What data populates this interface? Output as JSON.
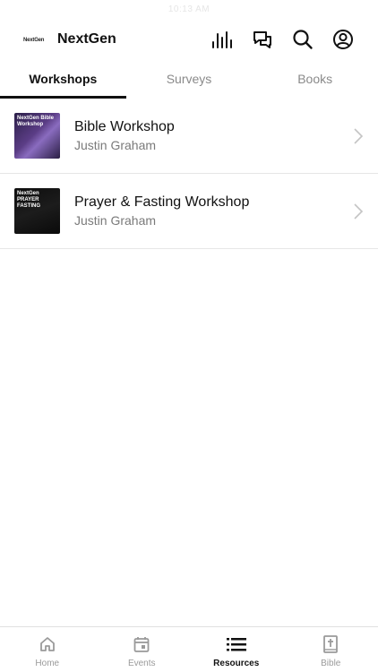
{
  "status": {
    "time": "10:13 AM"
  },
  "header": {
    "logo_text": "NextGen",
    "title": "NextGen",
    "icons": [
      "stats-icon",
      "chat-icon",
      "search-icon",
      "profile-icon"
    ]
  },
  "tabs": [
    {
      "label": "Workshops",
      "active": true
    },
    {
      "label": "Surveys",
      "active": false
    },
    {
      "label": "Books",
      "active": false
    }
  ],
  "items": [
    {
      "title": "Bible Workshop",
      "subtitle": "Justin Graham",
      "thumb_text": "NextGen Bible Workshop"
    },
    {
      "title": "Prayer & Fasting Workshop",
      "subtitle": "Justin Graham",
      "thumb_text": "NextGen PRAYER FASTING"
    }
  ],
  "tabbar": [
    {
      "label": "Home",
      "icon": "home-icon",
      "active": false
    },
    {
      "label": "Events",
      "icon": "calendar-icon",
      "active": false
    },
    {
      "label": "Resources",
      "icon": "list-icon",
      "active": true
    },
    {
      "label": "Bible",
      "icon": "bible-icon",
      "active": false
    }
  ],
  "colors": {
    "text": "#111111",
    "muted": "#8a8a8a",
    "divider": "#e6e6e6"
  }
}
